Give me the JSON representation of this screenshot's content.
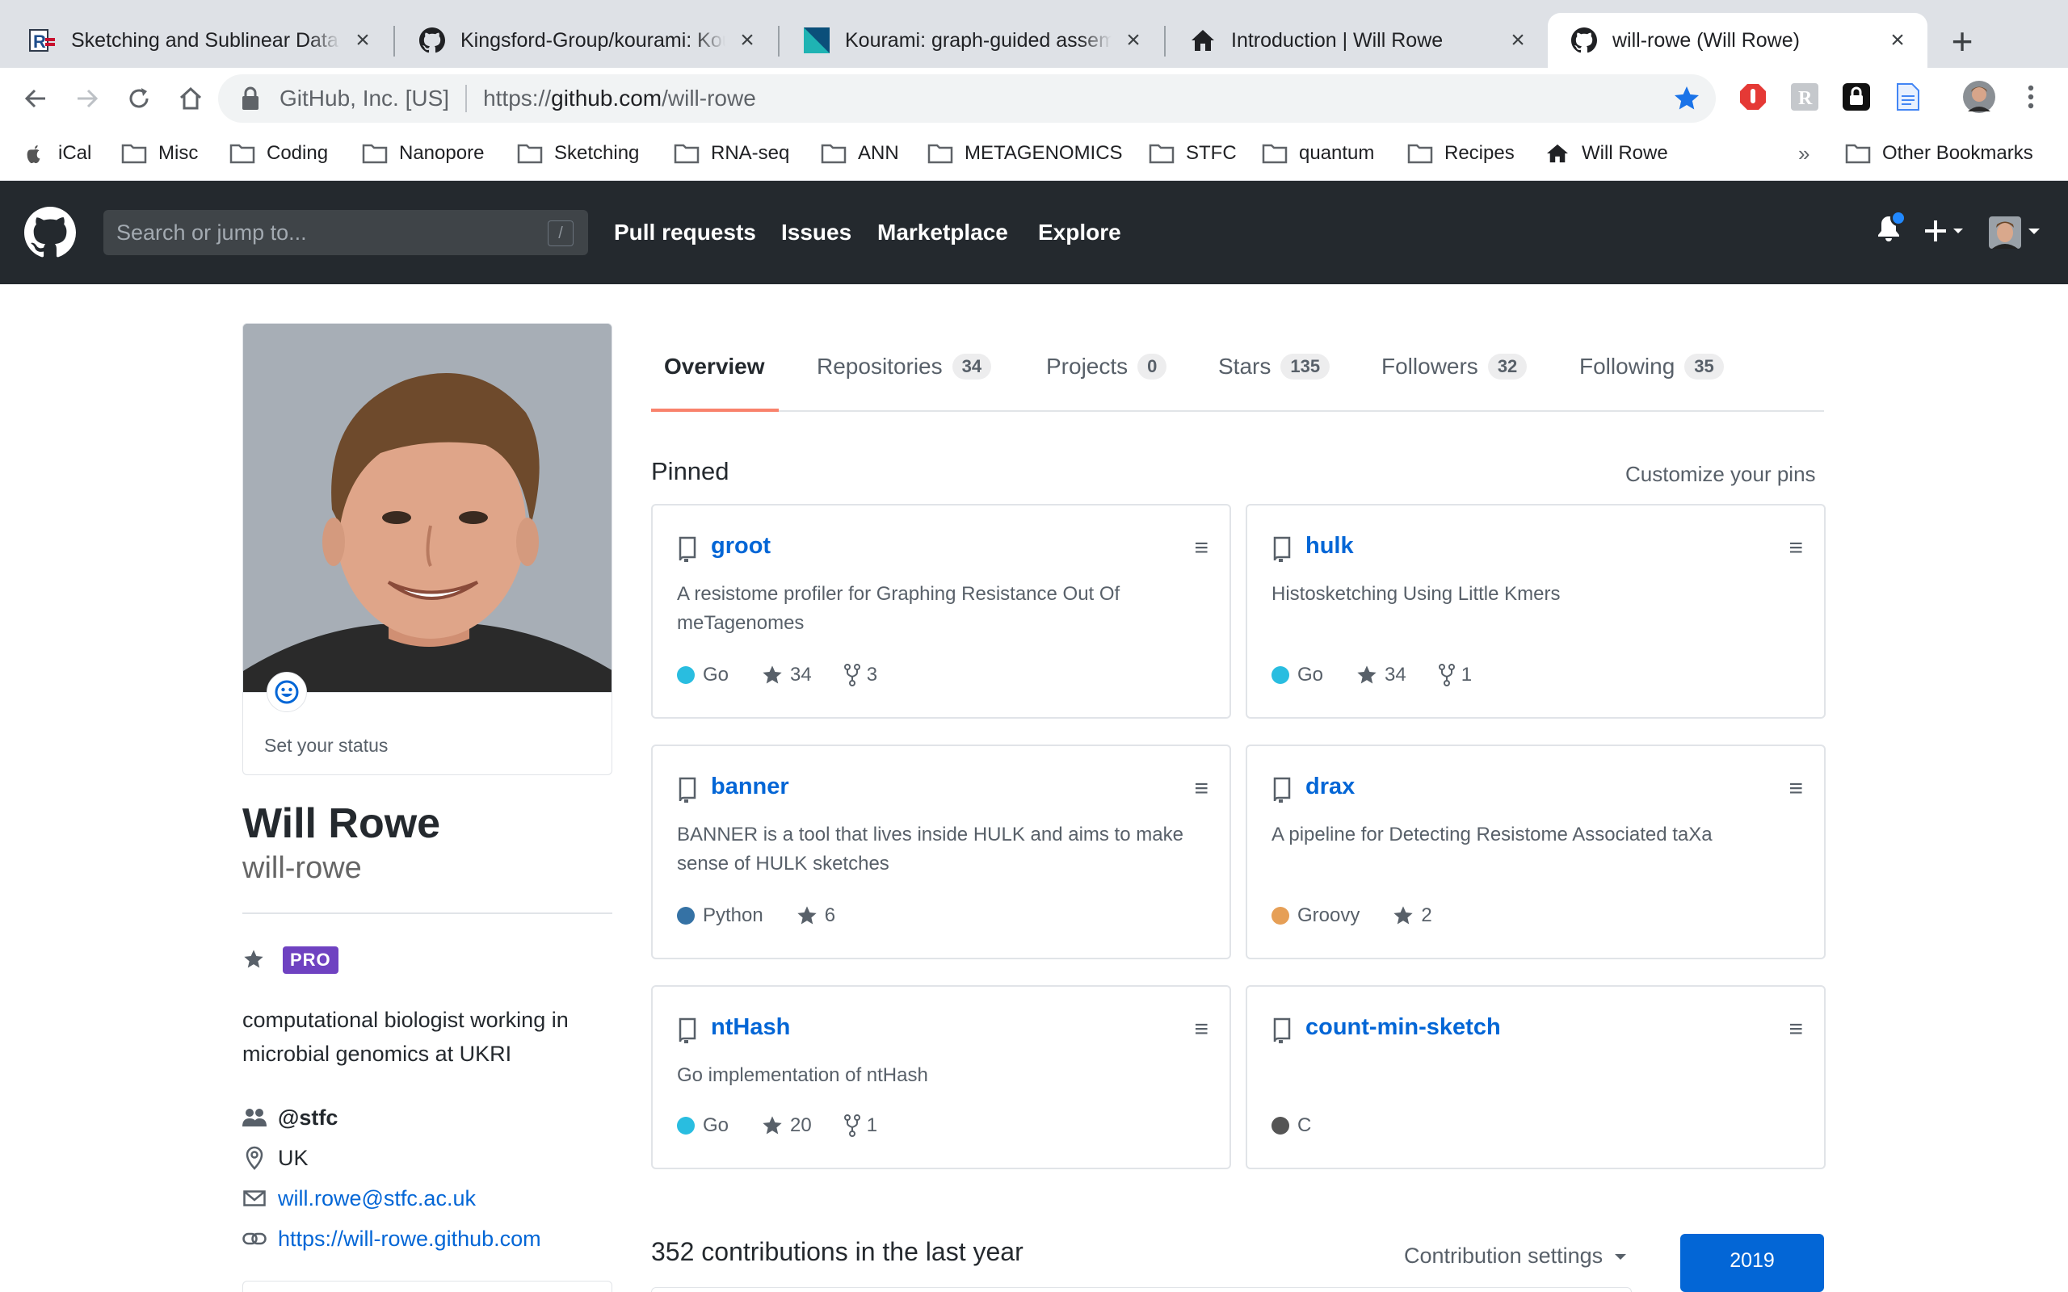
{
  "browser": {
    "tabs": [
      {
        "title": "Sketching and Sublinear Data S",
        "favicon": "r-icon"
      },
      {
        "title": "Kingsford-Group/kourami: Kou",
        "favicon": "github-icon"
      },
      {
        "title": "Kourami: graph-guided assemb",
        "favicon": "biomed-icon"
      },
      {
        "title": "Introduction | Will Rowe",
        "favicon": "home-icon"
      },
      {
        "title": "will-rowe (Will Rowe)",
        "favicon": "github-icon"
      }
    ],
    "address": {
      "site": "GitHub, Inc. [US]",
      "url_prefix": "https://",
      "url_host": "github.com",
      "url_path": "/will-rowe"
    },
    "bookmarks": [
      "iCal",
      "Misc",
      "Coding",
      "Nanopore",
      "Sketching",
      "RNA-seq",
      "ANN",
      "METAGENOMICS",
      "STFC",
      "quantum",
      "Recipes",
      "Will Rowe"
    ],
    "bookmarks_overflow": "»",
    "other_bookmarks": "Other Bookmarks"
  },
  "github_header": {
    "search_placeholder": "Search or jump to...",
    "search_shortcut": "/",
    "nav": [
      "Pull requests",
      "Issues",
      "Marketplace",
      "Explore"
    ]
  },
  "profile": {
    "status_label": "Set your status",
    "full_name": "Will Rowe",
    "login": "will-rowe",
    "badge": "PRO",
    "bio": "computational biologist working in microbial genomics at UKRI",
    "organization": "@stfc",
    "location": "UK",
    "email": "will.rowe@stfc.ac.uk",
    "website": "https://will-rowe.github.com"
  },
  "profile_tabs": [
    {
      "label": "Overview",
      "count": ""
    },
    {
      "label": "Repositories",
      "count": "34"
    },
    {
      "label": "Projects",
      "count": "0"
    },
    {
      "label": "Stars",
      "count": "135"
    },
    {
      "label": "Followers",
      "count": "32"
    },
    {
      "label": "Following",
      "count": "35"
    }
  ],
  "pinned": {
    "title": "Pinned",
    "customize": "Customize your pins",
    "repos": [
      {
        "name": "groot",
        "description": "A resistome profiler for Graphing Resistance Out Of meTagenomes",
        "language": "Go",
        "lang_color": "#29bde0",
        "stars": "34",
        "forks": "3"
      },
      {
        "name": "hulk",
        "description": "Histosketching Using Little Kmers",
        "language": "Go",
        "lang_color": "#29bde0",
        "stars": "34",
        "forks": "1"
      },
      {
        "name": "banner",
        "description": "BANNER is a tool that lives inside HULK and aims to make sense of HULK sketches",
        "language": "Python",
        "lang_color": "#3572A5",
        "stars": "6",
        "forks": ""
      },
      {
        "name": "drax",
        "description": "A pipeline for Detecting Resistome Associated taXa",
        "language": "Groovy",
        "lang_color": "#e69f56",
        "stars": "2",
        "forks": ""
      },
      {
        "name": "ntHash",
        "description": "Go implementation of ntHash",
        "language": "Go",
        "lang_color": "#29bde0",
        "stars": "20",
        "forks": "1"
      },
      {
        "name": "count-min-sketch",
        "description": "",
        "language": "C",
        "lang_color": "#555555",
        "stars": "",
        "forks": ""
      }
    ]
  },
  "contributions": {
    "title": "352 contributions in the last year",
    "settings": "Contribution settings",
    "year": "2019"
  }
}
